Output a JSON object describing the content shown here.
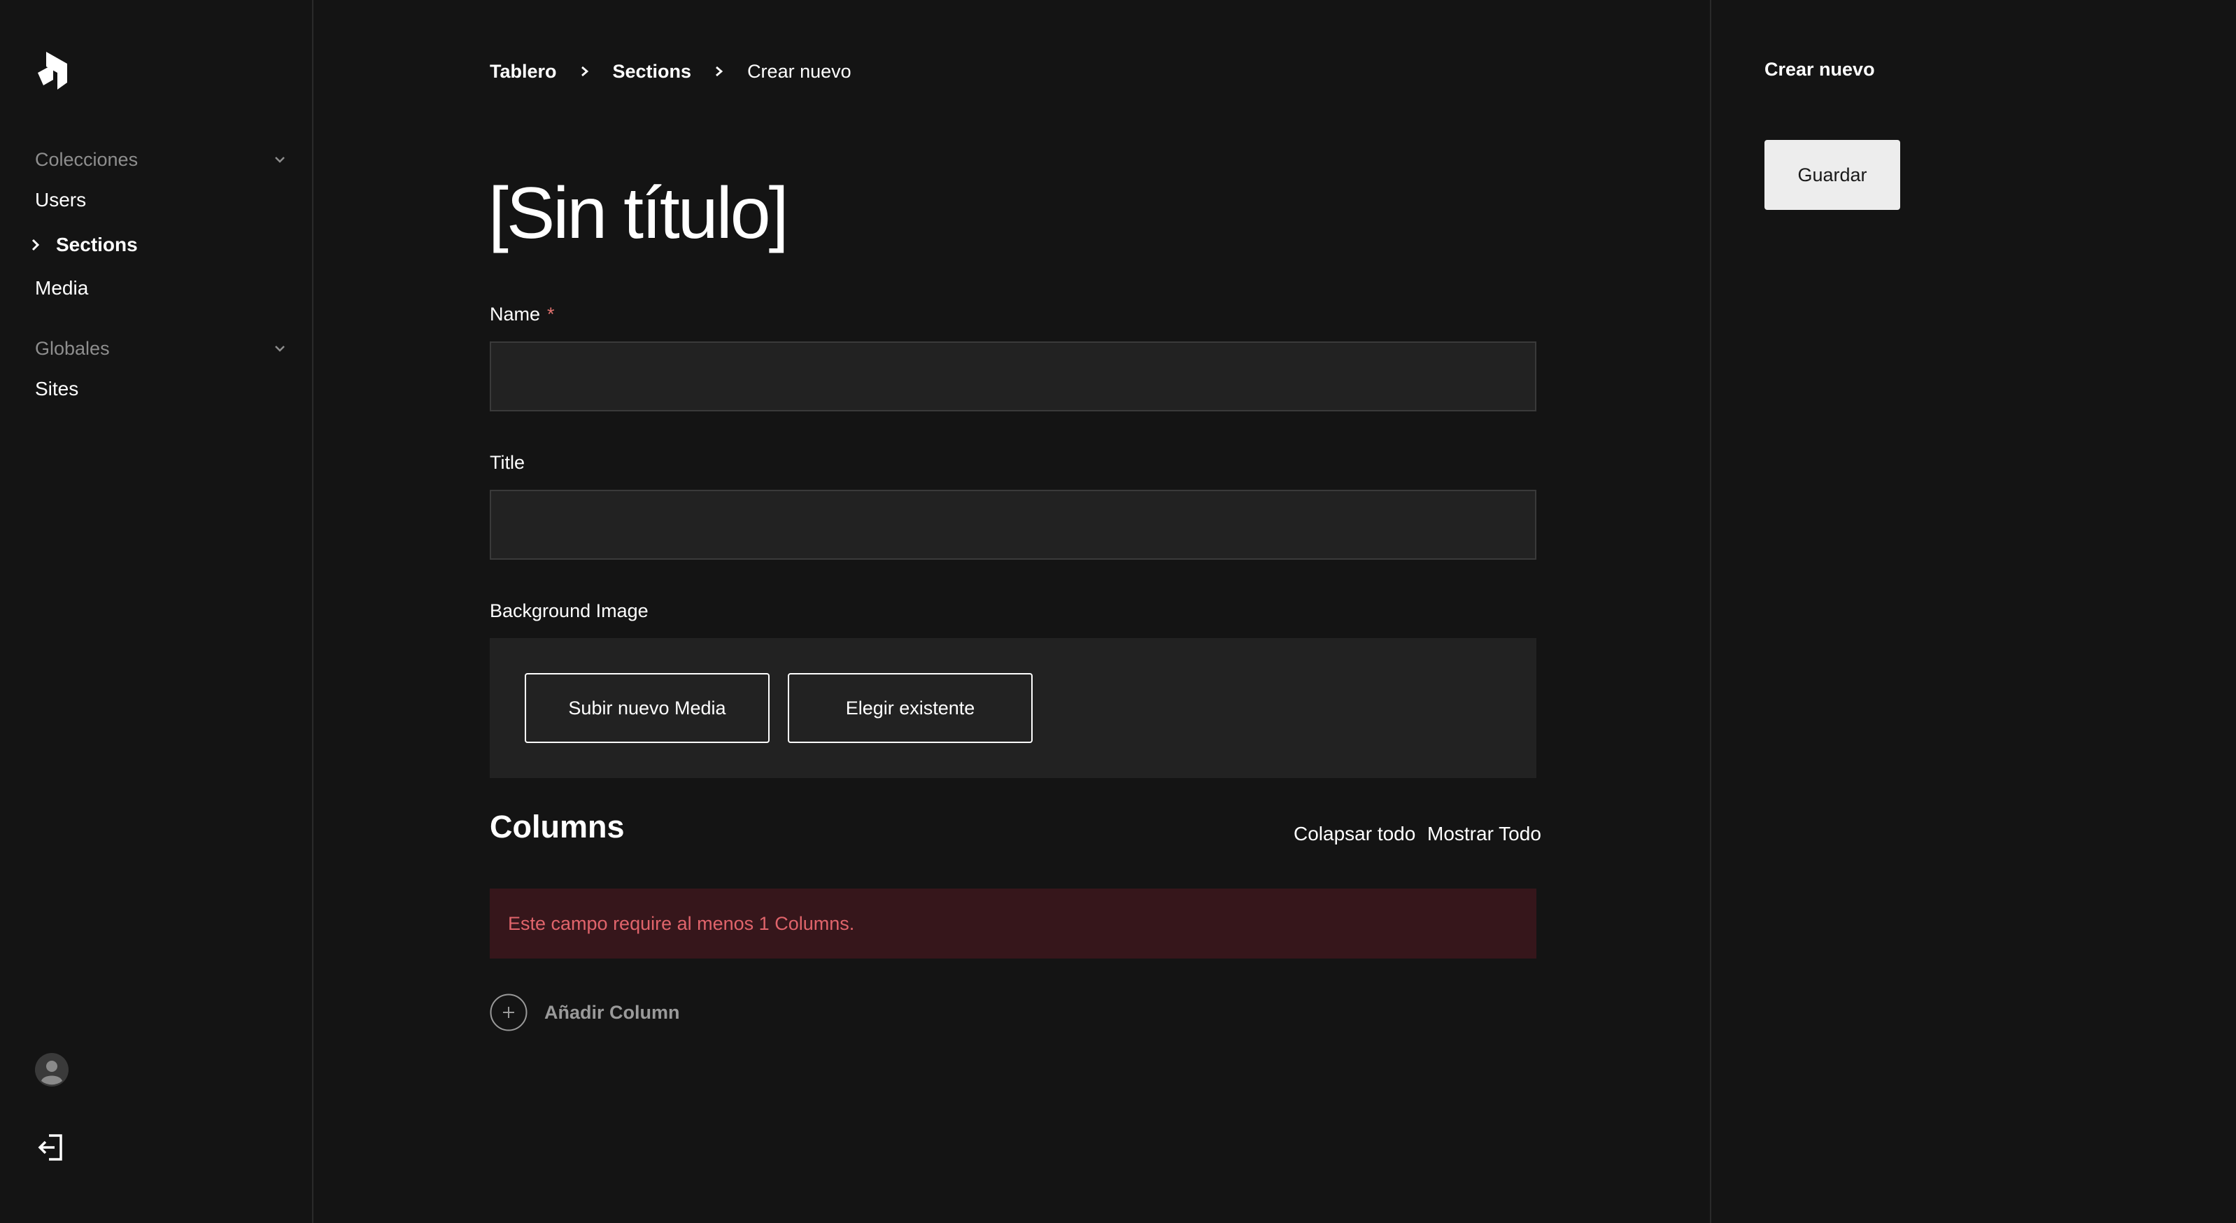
{
  "sidebar": {
    "logo": "payload-logo-icon",
    "groups": [
      {
        "label": "Colecciones",
        "items": [
          "Users",
          "Sections",
          "Media"
        ]
      },
      {
        "label": "Globales",
        "items": [
          "Sites"
        ]
      }
    ],
    "active_item": "Sections"
  },
  "breadcrumb": {
    "items": [
      "Tablero",
      "Sections"
    ],
    "current": "Crear nuevo"
  },
  "main": {
    "title": "[Sin título]",
    "fields": {
      "name": {
        "label": "Name",
        "required_mark": "*",
        "value": ""
      },
      "title": {
        "label": "Title",
        "value": ""
      },
      "background_image": {
        "label": "Background Image",
        "upload_label": "Subir nuevo Media",
        "choose_label": "Elegir existente"
      }
    },
    "columns": {
      "heading": "Columns",
      "collapse_all": "Colapsar todo",
      "show_all": "Mostrar Todo",
      "error": "Este campo require al menos 1 Columns.",
      "add_label": "Añadir Column"
    }
  },
  "right_panel": {
    "title": "Crear nuevo",
    "save_label": "Guardar"
  },
  "colors": {
    "background": "#141414",
    "input_bg": "#222222",
    "error_bg": "#36161b",
    "error_text": "#e0646b",
    "required": "#e0726f"
  }
}
